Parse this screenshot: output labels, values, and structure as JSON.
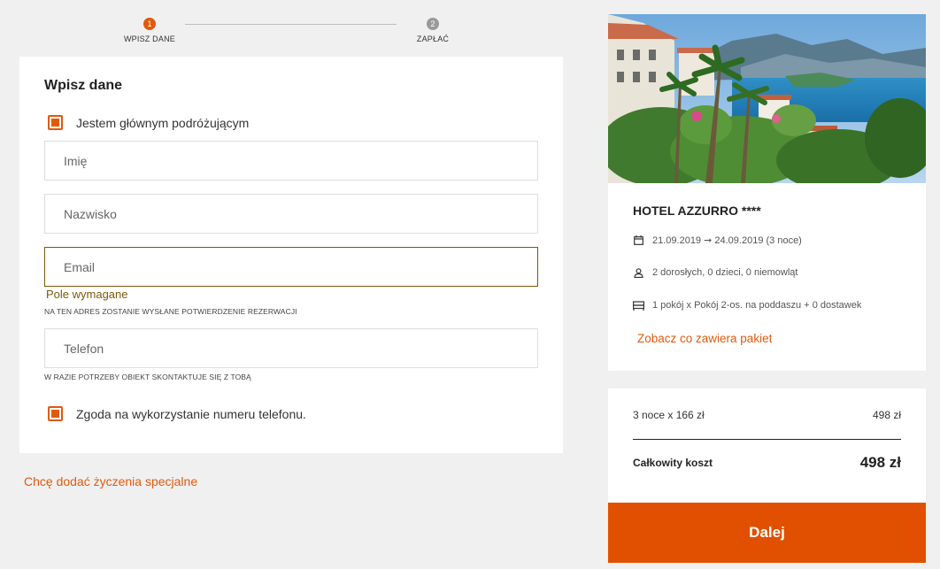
{
  "stepper": {
    "steps": [
      {
        "num": "1",
        "label": "WPISZ DANE"
      },
      {
        "num": "2",
        "label": "ZAPŁAĆ"
      }
    ]
  },
  "form": {
    "title": "Wpisz dane",
    "main_traveler_label": "Jestem głównym podróżującym",
    "first_name_placeholder": "Imię",
    "last_name_placeholder": "Nazwisko",
    "email_placeholder": "Email",
    "email_error": "Pole wymagane",
    "email_hint": "NA TEN ADRES ZOSTANIE WYSŁANE POTWIERDZENIE REZERWACJI",
    "phone_placeholder": "Telefon",
    "phone_hint": "W RAZIE POTRZEBY OBIEKT SKONTAKTUJE SIĘ Z TOBĄ",
    "phone_consent_label": "Zgoda na wykorzystanie numeru telefonu."
  },
  "special_requests_link": "Chcę dodać życzenia specjalne",
  "hotel": {
    "name": "HOTEL AZZURRO ****",
    "dates": "21.09.2019 ➞ 24.09.2019 (3 noce)",
    "guests": "2 dorosłych, 0 dzieci, 0 niemowląt",
    "room": "1 pokój x Pokój 2-os. na poddaszu + 0 dostawek",
    "package_link": "Zobacz co zawiera pakiet"
  },
  "price": {
    "nights_label": "3 noce x 166 zł",
    "nights_value": "498 zł",
    "total_label": "Całkowity koszt",
    "total_value": "498 zł"
  },
  "next_button": "Dalej",
  "colors": {
    "accent": "#e05a0c",
    "error": "#7a5a08",
    "background": "#f0f0f0"
  }
}
